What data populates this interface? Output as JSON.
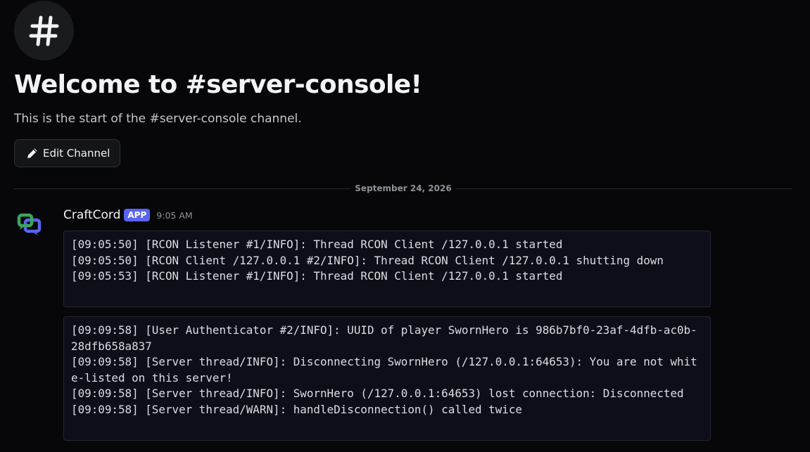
{
  "channel": {
    "icon": "hashtag-icon",
    "welcome_title": "Welcome to #server-console!",
    "welcome_subtitle": "This is the start of the #server-console channel.",
    "edit_button_label": "Edit Channel",
    "edit_button_icon": "pencil-icon"
  },
  "divider": {
    "date": "September 24, 2026"
  },
  "message": {
    "author": "CraftCord",
    "badge": "APP",
    "timestamp": "9:05 AM",
    "avatar_icon": "craftcord-logo-icon",
    "blocks": [
      {
        "lines": [
          "[09:05:50] [RCON Listener #1/INFO]: Thread RCON Client /127.0.0.1 started",
          "[09:05:50] [RCON Client /127.0.0.1 #2/INFO]: Thread RCON Client /127.0.0.1 shutting down",
          "[09:05:53] [RCON Listener #1/INFO]: Thread RCON Client /127.0.0.1 started"
        ]
      },
      {
        "lines": [
          "[09:09:58] [User Authenticator #2/INFO]: UUID of player SwornHero is 986b7bf0-23af-4dfb-ac0b-28dfb658a837",
          "[09:09:58] [Server thread/INFO]: Disconnecting SwornHero (/127.0.0.1:64653): You are not white-listed on this server!",
          "[09:09:58] [Server thread/INFO]: SwornHero (/127.0.0.1:64653) lost connection: Disconnected",
          "[09:09:58] [Server thread/WARN]: handleDisconnection() called twice"
        ]
      }
    ]
  },
  "colors": {
    "background": "#070709",
    "badge": "#5865f2",
    "avatar_green": "#3ba55d",
    "avatar_purple": "#5865f2"
  }
}
